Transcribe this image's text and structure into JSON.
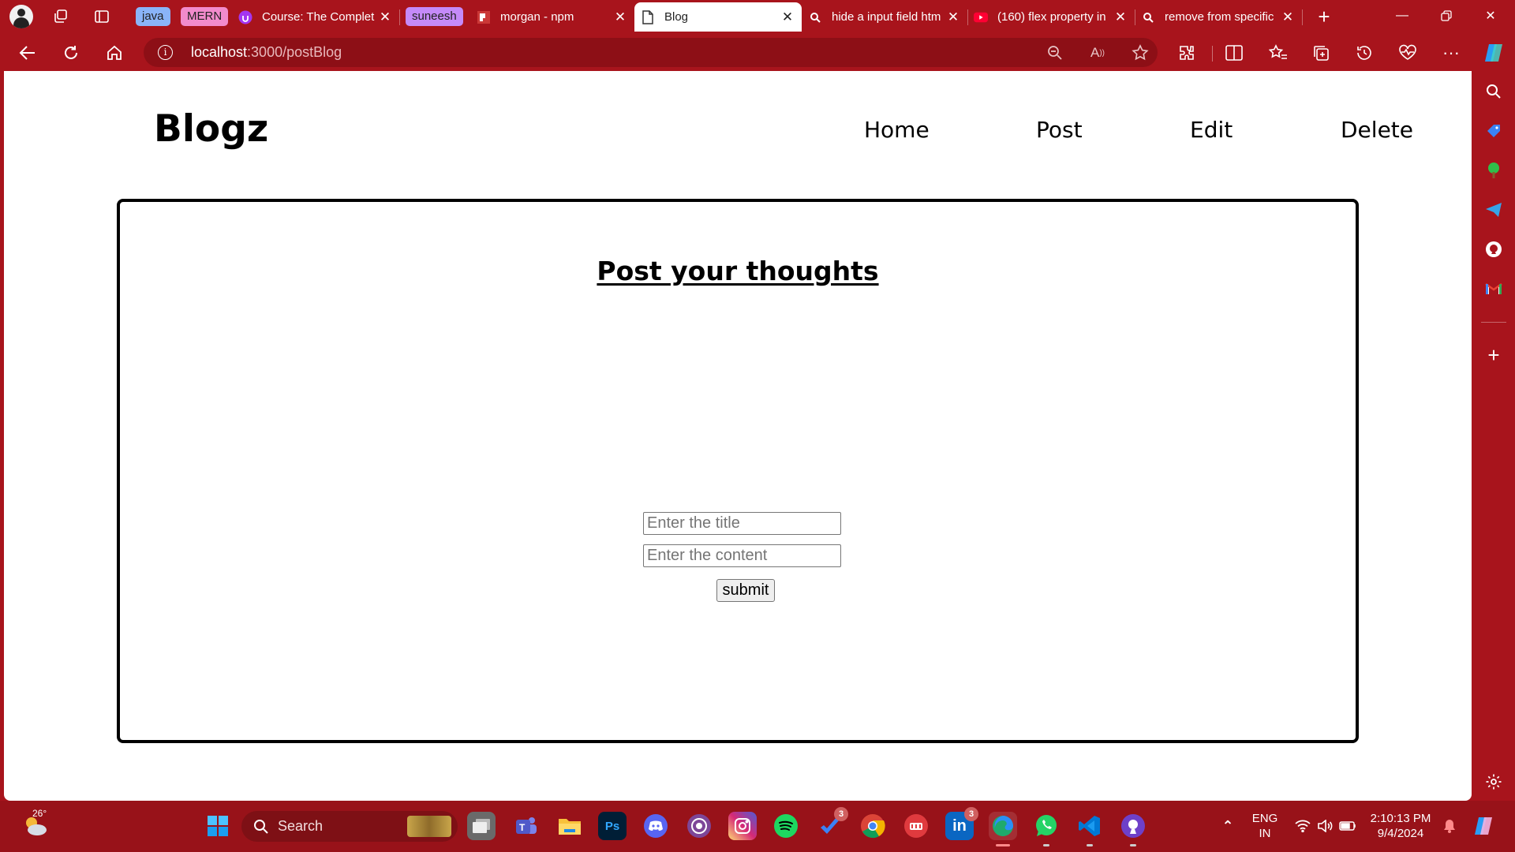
{
  "browser": {
    "tab_groups": [
      {
        "label": "java",
        "color": "#8ab4f8"
      },
      {
        "label": "MERN",
        "color": "#f28bcc"
      },
      {
        "label": "suneesh",
        "color": "#c58af9"
      }
    ],
    "tabs": [
      {
        "title": "Course: The Complet",
        "icon": "udemy-icon"
      },
      {
        "title": "morgan - npm",
        "icon": "npm-icon"
      },
      {
        "title": "Blog",
        "icon": "page-icon",
        "active": true
      },
      {
        "title": "hide a input field htm",
        "icon": "search-icon"
      },
      {
        "title": "(160) flex property in",
        "icon": "youtube-icon"
      },
      {
        "title": "remove from specific",
        "icon": "search-icon"
      }
    ],
    "url_host": "localhost",
    "url_path": ":3000/postBlog"
  },
  "page": {
    "brand": "Blogz",
    "nav": [
      "Home",
      "Post",
      "Edit",
      "Delete"
    ],
    "heading": "Post your thoughts",
    "title_placeholder": "Enter the title",
    "content_placeholder": "Enter the content",
    "submit_label": "submit"
  },
  "taskbar": {
    "weather": "26°",
    "search_label": "Search",
    "language": "ENG",
    "region": "IN",
    "time": "2:10:13 PM",
    "date": "9/4/2024",
    "badge_pinned": "3",
    "badge_linkedin": "3"
  },
  "colors": {
    "accent": "#a8141c",
    "page_bg": "#ffffff"
  }
}
